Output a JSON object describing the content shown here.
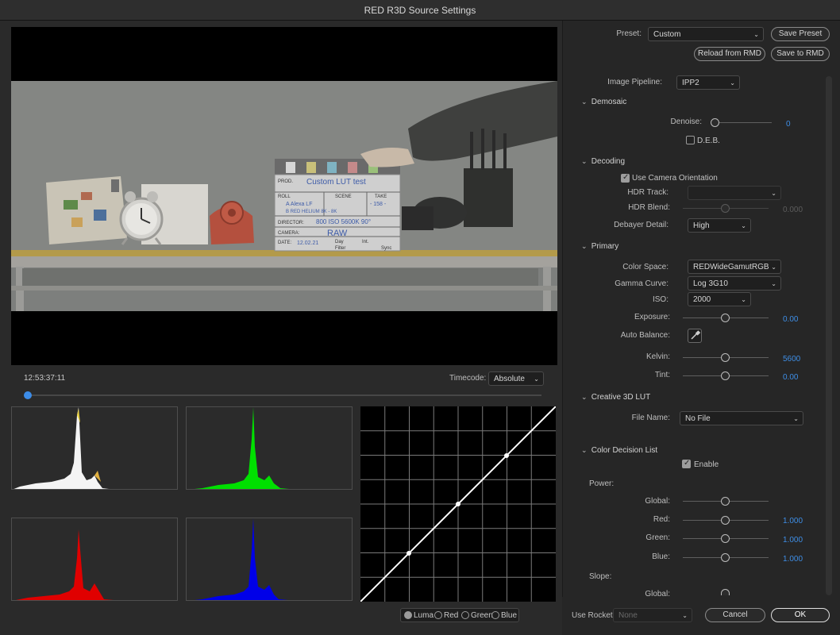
{
  "window": {
    "title": "RED R3D Source Settings"
  },
  "viewer": {
    "timecode": "12:53:37:11",
    "timecode_label": "Timecode:",
    "timecode_mode": "Absolute",
    "slate": {
      "prod_label": "PROD.",
      "prod": "Custom LUT test",
      "roll_label": "ROLL",
      "scene_label": "SCENE",
      "take_label": "TAKE",
      "roll_line": "A Alexa LF",
      "scene_line": "- 158 -",
      "roll_line2": "B RED HELIUM 8K - 8K",
      "director_label": "DIRECTOR:",
      "director": "800 ISO   5600K 90°",
      "camera_label": "CAMERA:",
      "camera": "RAW",
      "date_label": "DATE:",
      "date": "12.02.21",
      "day_label": "Day",
      "int_label": "Int.",
      "filter_label": "Filter",
      "sync_label": "Sync"
    }
  },
  "histogram_channels": {
    "luma": "Luma",
    "red": "Red",
    "green": "Green",
    "blue": "Blue"
  },
  "colors": {
    "accent": "#3c8ce8",
    "green": "#00e000",
    "red": "#e00000",
    "blue": "#0000e8"
  },
  "header": {
    "preset_label": "Preset:",
    "preset_value": "Custom",
    "save_preset": "Save Preset",
    "reload_rmd": "Reload from RMD",
    "save_rmd": "Save to RMD"
  },
  "settings": {
    "image_pipeline_label": "Image Pipeline:",
    "image_pipeline": "IPP2",
    "demosaic": "Demosaic",
    "denoise_label": "Denoise:",
    "denoise_value": "0",
    "deb_label": "D.E.B.",
    "decoding": "Decoding",
    "use_camera_orientation": "Use Camera Orientation",
    "hdr_track_label": "HDR Track:",
    "hdr_blend_label": "HDR Blend:",
    "hdr_blend_value": "0.000",
    "debayer_label": "Debayer Detail:",
    "debayer_value": "High",
    "primary": "Primary",
    "color_space_label": "Color Space:",
    "color_space": "REDWideGamutRGB",
    "gamma_label": "Gamma Curve:",
    "gamma": "Log 3G10",
    "iso_label": "ISO:",
    "iso": "2000",
    "exposure_label": "Exposure:",
    "exposure_value": "0.00",
    "auto_balance_label": "Auto Balance:",
    "kelvin_label": "Kelvin:",
    "kelvin_value": "5600",
    "tint_label": "Tint:",
    "tint_value": "0.00",
    "lut": "Creative 3D LUT",
    "file_name_label": "File Name:",
    "file_name": "No File",
    "cdl": "Color Decision List",
    "enable_label": "Enable",
    "power_label": "Power:",
    "global_label": "Global:",
    "red_label": "Red:",
    "red_value": "1.000",
    "green_label": "Green:",
    "green_value": "1.000",
    "blue_label": "Blue:",
    "blue_value": "1.000",
    "slope_label": "Slope:",
    "global2_label": "Global:"
  },
  "footer": {
    "use_rocket_label": "Use Rocket:",
    "use_rocket_value": "None",
    "cancel": "Cancel",
    "ok": "OK"
  }
}
